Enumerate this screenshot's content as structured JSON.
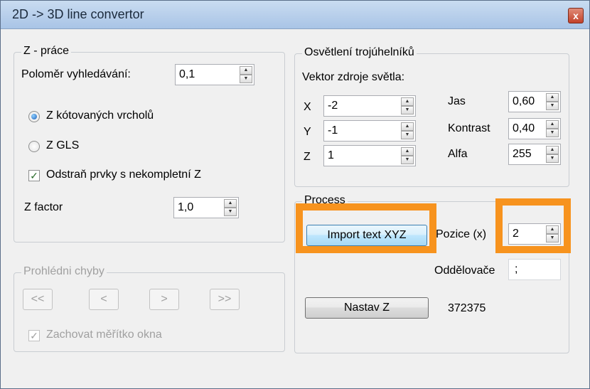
{
  "window": {
    "title": "2D -> 3D line convertor",
    "close": "x"
  },
  "zprace": {
    "legend": "Z - práce",
    "polomer_label": "Poloměr vyhledávání:",
    "polomer_value": "0,1",
    "radio_kotovanych": "Z kótovaných vrcholů",
    "radio_gls": "Z GLS",
    "odstran_label": "Odstraň prvky s  nekompletní Z",
    "zfactor_label": "Z factor",
    "zfactor_value": "1,0"
  },
  "osvetleni": {
    "legend": "Osvětlení trojúhelníků",
    "vektor_label": "Vektor zdroje světla:",
    "x_label": "X",
    "x_value": "-2",
    "y_label": "Y",
    "y_value": "-1",
    "z_label": "Z",
    "z_value": "1",
    "jas_label": "Jas",
    "jas_value": "0,60",
    "kontrast_label": "Kontrast",
    "kontrast_value": "0,40",
    "alfa_label": "Alfa",
    "alfa_value": "255"
  },
  "process": {
    "legend": "Process",
    "import_button": "Import text XYZ",
    "pozice_label": "Pozice (x)",
    "pozice_value": "2",
    "oddelovace_label": "Oddělovače",
    "oddelovace_value": ";",
    "nastav_button": "Nastav Z",
    "count": "372375"
  },
  "chyby": {
    "legend": "Prohlédni chyby",
    "first": "<<",
    "prev": "<",
    "next": ">",
    "last": ">>",
    "zachovat_label": "Zachovat měřítko okna"
  },
  "colors": {
    "highlight": "#f7931e",
    "titlebar": "#b7cfee"
  }
}
